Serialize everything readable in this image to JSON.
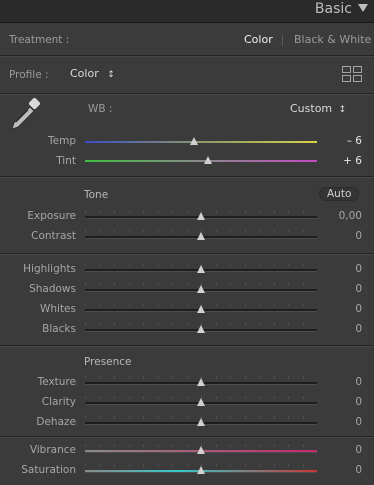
{
  "header": {
    "title": "Basic"
  },
  "treatment": {
    "label": "Treatment :",
    "color": "Color",
    "bw": "Black & White"
  },
  "profile": {
    "label": "Profile :",
    "value": "Color",
    "chevron": "↕"
  },
  "wb": {
    "label": "WB :",
    "value": "Custom",
    "chevron": "↕"
  },
  "icons": {
    "eyedropper": "eyedropper-icon",
    "grid": "profile-grid-icon",
    "collapse": "collapse-triangle-icon"
  },
  "sliders": {
    "temp": {
      "label": "Temp",
      "value": "– 6",
      "level": 0.47
    },
    "tint": {
      "label": "Tint",
      "value": "+ 6",
      "level": 0.53
    },
    "exposure": {
      "label": "Exposure",
      "value": "0,00",
      "level": 0.5
    },
    "contrast": {
      "label": "Contrast",
      "value": "0",
      "level": 0.5
    },
    "highlights": {
      "label": "Highlights",
      "value": "0",
      "level": 0.5
    },
    "shadows": {
      "label": "Shadows",
      "value": "0",
      "level": 0.5
    },
    "whites": {
      "label": "Whites",
      "value": "0",
      "level": 0.5
    },
    "blacks": {
      "label": "Blacks",
      "value": "0",
      "level": 0.5
    },
    "texture": {
      "label": "Texture",
      "value": "0",
      "level": 0.5
    },
    "clarity": {
      "label": "Clarity",
      "value": "0",
      "level": 0.5
    },
    "dehaze": {
      "label": "Dehaze",
      "value": "0",
      "level": 0.5
    },
    "vibrance": {
      "label": "Vibrance",
      "value": "0",
      "level": 0.5
    },
    "saturation": {
      "label": "Saturation",
      "value": "0",
      "level": 0.5
    }
  },
  "tone": {
    "title": "Tone",
    "auto": "Auto"
  },
  "presence": {
    "title": "Presence"
  },
  "colors": {
    "temp_gradient": [
      "#3c4cc8",
      "#8a9a6a",
      "#d8d24a"
    ],
    "tint_gradient": [
      "#3fbf3f",
      "#8a8a8a",
      "#c34bc3"
    ],
    "vibrance_gradient": [
      "#8a8a8a",
      "#c6286e"
    ],
    "saturation_gradient": [
      "#8a8a8a",
      "#35c9c9",
      "#c93535"
    ]
  }
}
